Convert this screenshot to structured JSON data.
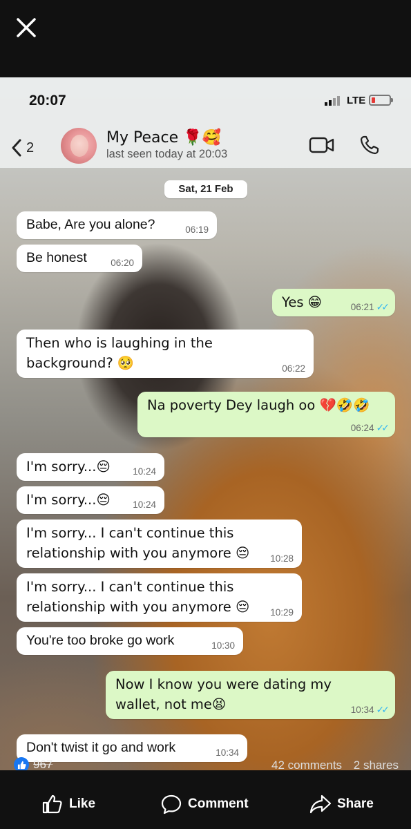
{
  "viewer": {
    "close_label": "close"
  },
  "status_bar": {
    "time": "20:07",
    "network": "LTE"
  },
  "chat_header": {
    "back_count": "2",
    "contact_name": "My Peace 🌹🥰",
    "last_seen": "last seen today at 20:03"
  },
  "date_separator": "Sat, 21 Feb",
  "messages": [
    {
      "dir": "in",
      "text": "Babe, Are you alone?",
      "time": "06:19"
    },
    {
      "dir": "in",
      "text": "Be honest",
      "time": "06:20"
    },
    {
      "dir": "out",
      "text": "Yes 😁",
      "time": "06:21",
      "ticks": "✓✓"
    },
    {
      "dir": "in",
      "text": "Then who is laughing in the background? 🥺",
      "time": "06:22"
    },
    {
      "dir": "out",
      "text": "Na poverty  Dey laugh oo 💔🤣🤣",
      "time": "06:24",
      "ticks": "✓✓"
    },
    {
      "dir": "in",
      "text": "I'm sorry...😔",
      "time": "10:24"
    },
    {
      "dir": "in",
      "text": "I'm sorry...😔",
      "time": "10:24"
    },
    {
      "dir": "in",
      "text": "I'm sorry... I can't continue this relationship with you anymore 😔",
      "time": "10:28"
    },
    {
      "dir": "in",
      "text": "I'm sorry... I can't continue this relationship with you anymore 😔",
      "time": "10:29"
    },
    {
      "dir": "in",
      "text": "You're too broke go work",
      "time": "10:30"
    },
    {
      "dir": "out",
      "text": "Now I know you were dating my  wallet, not me😫",
      "time": "10:34",
      "ticks": "✓✓"
    },
    {
      "dir": "in",
      "text": "Don't twist it go and work",
      "time": "10:34"
    }
  ],
  "post_stats": {
    "reactions": "967",
    "comments": "42 comments",
    "shares": "2 shares"
  },
  "actions": {
    "like": "Like",
    "comment": "Comment",
    "share": "Share"
  },
  "colors": {
    "incoming": "#ffffff",
    "outgoing": "#dcf8c6",
    "ticks": "#34b7f1",
    "like_blue": "#1877f2"
  }
}
